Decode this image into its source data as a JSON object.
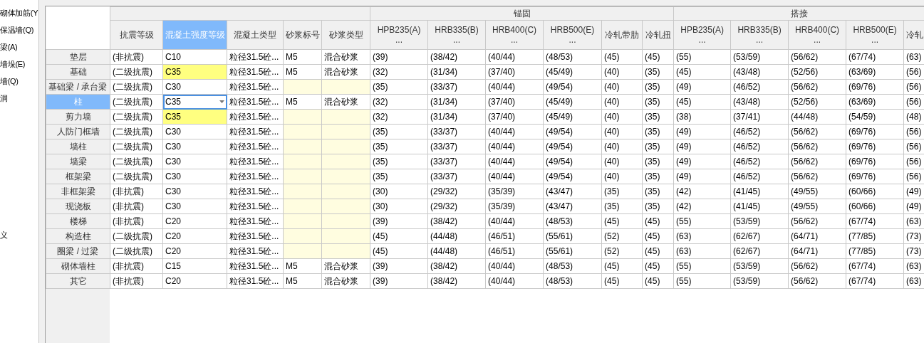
{
  "sidebar": {
    "items": [
      "砌体加筋(Y",
      "保温墙(Q)",
      "梁(A)",
      "墙垛(E)",
      "墙(Q)",
      "洞",
      "义"
    ]
  },
  "table": {
    "columns": [
      {
        "label": "抗震等级",
        "selected": false
      },
      {
        "label": "混凝土强度等级",
        "selected": true
      },
      {
        "label": "混凝土类型",
        "selected": false
      },
      {
        "label": "砂浆标号",
        "selected": false
      },
      {
        "label": "砂浆类型",
        "selected": false
      }
    ],
    "groups": [
      {
        "label": "锚固",
        "columns": [
          {
            "label": "HPB235(A)",
            "more": "...",
            "selected": false
          },
          {
            "label": "HRB335(B)",
            "more": "...",
            "selected": false
          },
          {
            "label": "HRB400(C)",
            "more": "...",
            "selected": false
          },
          {
            "label": "HRB500(E)",
            "more": "...",
            "selected": false
          },
          {
            "label": "冷轧带肋",
            "selected": false
          },
          {
            "label": "冷轧扭",
            "selected": false
          }
        ]
      },
      {
        "label": "搭接",
        "columns": [
          {
            "label": "HPB235(A)",
            "more": "...",
            "selected": false
          },
          {
            "label": "HRB335(B)",
            "more": "...",
            "selected": false
          },
          {
            "label": "HRB400(C)",
            "more": "...",
            "selected": false
          },
          {
            "label": "HRB500(E)",
            "more": "...",
            "selected": false
          },
          {
            "label": "冷轧",
            "selected": false
          }
        ]
      }
    ],
    "rows": [
      {
        "label": "垫层",
        "selected": false,
        "seismic": "(非抗震)",
        "grade": "C10",
        "grade_modified": false,
        "editing": false,
        "concrete": "粒径31.5砼...",
        "mortar": {
          "mark": "M5",
          "type": "混合砂浆"
        },
        "values": [
          "(39)",
          "(38/42)",
          "(40/44)",
          "(48/53)",
          "(45)",
          "(45)",
          "(55)",
          "(53/59)",
          "(56/62)",
          "(67/74)",
          "(63)"
        ]
      },
      {
        "label": "基础",
        "selected": false,
        "seismic": "(二级抗震)",
        "grade": "C35",
        "grade_modified": true,
        "editing": false,
        "concrete": "粒径31.5砼...",
        "mortar": {
          "mark": "M5",
          "type": "混合砂浆"
        },
        "values": [
          "(32)",
          "(31/34)",
          "(37/40)",
          "(45/49)",
          "(40)",
          "(35)",
          "(45)",
          "(43/48)",
          "(52/56)",
          "(63/69)",
          "(56)"
        ]
      },
      {
        "label": "基础梁 / 承台梁",
        "selected": false,
        "seismic": "(二级抗震)",
        "grade": "C30",
        "grade_modified": false,
        "editing": false,
        "concrete": "粒径31.5砼...",
        "mortar": null,
        "values": [
          "(35)",
          "(33/37)",
          "(40/44)",
          "(49/54)",
          "(40)",
          "(35)",
          "(49)",
          "(46/52)",
          "(56/62)",
          "(69/76)",
          "(56)"
        ]
      },
      {
        "label": "柱",
        "selected": true,
        "seismic": "(二级抗震)",
        "grade": "C35",
        "grade_modified": false,
        "editing": true,
        "concrete": "粒径31.5砼...",
        "mortar": {
          "mark": "M5",
          "type": "混合砂浆"
        },
        "values": [
          "(32)",
          "(31/34)",
          "(37/40)",
          "(45/49)",
          "(40)",
          "(35)",
          "(45)",
          "(43/48)",
          "(52/56)",
          "(63/69)",
          "(56)"
        ]
      },
      {
        "label": "剪力墙",
        "selected": false,
        "seismic": "(二级抗震)",
        "grade": "C35",
        "grade_modified": true,
        "editing": false,
        "concrete": "粒径31.5砼...",
        "mortar": null,
        "values": [
          "(32)",
          "(31/34)",
          "(37/40)",
          "(45/49)",
          "(40)",
          "(35)",
          "(38)",
          "(37/41)",
          "(44/48)",
          "(54/59)",
          "(48)"
        ]
      },
      {
        "label": "人防门框墙",
        "selected": false,
        "seismic": "(二级抗震)",
        "grade": "C30",
        "grade_modified": false,
        "editing": false,
        "concrete": "粒径31.5砼...",
        "mortar": null,
        "values": [
          "(35)",
          "(33/37)",
          "(40/44)",
          "(49/54)",
          "(40)",
          "(35)",
          "(49)",
          "(46/52)",
          "(56/62)",
          "(69/76)",
          "(56)"
        ]
      },
      {
        "label": "墙柱",
        "selected": false,
        "seismic": "(二级抗震)",
        "grade": "C30",
        "grade_modified": false,
        "editing": false,
        "concrete": "粒径31.5砼...",
        "mortar": null,
        "values": [
          "(35)",
          "(33/37)",
          "(40/44)",
          "(49/54)",
          "(40)",
          "(35)",
          "(49)",
          "(46/52)",
          "(56/62)",
          "(69/76)",
          "(56)"
        ]
      },
      {
        "label": "墙梁",
        "selected": false,
        "seismic": "(二级抗震)",
        "grade": "C30",
        "grade_modified": false,
        "editing": false,
        "concrete": "粒径31.5砼...",
        "mortar": null,
        "values": [
          "(35)",
          "(33/37)",
          "(40/44)",
          "(49/54)",
          "(40)",
          "(35)",
          "(49)",
          "(46/52)",
          "(56/62)",
          "(69/76)",
          "(56)"
        ]
      },
      {
        "label": "框架梁",
        "selected": false,
        "seismic": "(二级抗震)",
        "grade": "C30",
        "grade_modified": false,
        "editing": false,
        "concrete": "粒径31.5砼...",
        "mortar": null,
        "values": [
          "(35)",
          "(33/37)",
          "(40/44)",
          "(49/54)",
          "(40)",
          "(35)",
          "(49)",
          "(46/52)",
          "(56/62)",
          "(69/76)",
          "(56)"
        ]
      },
      {
        "label": "非框架梁",
        "selected": false,
        "seismic": "(非抗震)",
        "grade": "C30",
        "grade_modified": false,
        "editing": false,
        "concrete": "粒径31.5砼...",
        "mortar": null,
        "values": [
          "(30)",
          "(29/32)",
          "(35/39)",
          "(43/47)",
          "(35)",
          "(35)",
          "(42)",
          "(41/45)",
          "(49/55)",
          "(60/66)",
          "(49)"
        ]
      },
      {
        "label": "现浇板",
        "selected": false,
        "seismic": "(非抗震)",
        "grade": "C30",
        "grade_modified": false,
        "editing": false,
        "concrete": "粒径31.5砼...",
        "mortar": null,
        "values": [
          "(30)",
          "(29/32)",
          "(35/39)",
          "(43/47)",
          "(35)",
          "(35)",
          "(42)",
          "(41/45)",
          "(49/55)",
          "(60/66)",
          "(49)"
        ]
      },
      {
        "label": "楼梯",
        "selected": false,
        "seismic": "(非抗震)",
        "grade": "C20",
        "grade_modified": false,
        "editing": false,
        "concrete": "粒径31.5砼...",
        "mortar": null,
        "values": [
          "(39)",
          "(38/42)",
          "(40/44)",
          "(48/53)",
          "(45)",
          "(45)",
          "(55)",
          "(53/59)",
          "(56/62)",
          "(67/74)",
          "(63)"
        ]
      },
      {
        "label": "构造柱",
        "selected": false,
        "seismic": "(二级抗震)",
        "grade": "C20",
        "grade_modified": false,
        "editing": false,
        "concrete": "粒径31.5砼...",
        "mortar": null,
        "values": [
          "(45)",
          "(44/48)",
          "(46/51)",
          "(55/61)",
          "(52)",
          "(45)",
          "(63)",
          "(62/67)",
          "(64/71)",
          "(77/85)",
          "(73)"
        ]
      },
      {
        "label": "圈梁 / 过梁",
        "selected": false,
        "seismic": "(二级抗震)",
        "grade": "C20",
        "grade_modified": false,
        "editing": false,
        "concrete": "粒径31.5砼...",
        "mortar": null,
        "values": [
          "(45)",
          "(44/48)",
          "(46/51)",
          "(55/61)",
          "(52)",
          "(45)",
          "(63)",
          "(62/67)",
          "(64/71)",
          "(77/85)",
          "(73)"
        ]
      },
      {
        "label": "砌体墙柱",
        "selected": false,
        "seismic": "(非抗震)",
        "grade": "C15",
        "grade_modified": false,
        "editing": false,
        "concrete": "粒径31.5砼...",
        "mortar": {
          "mark": "M5",
          "type": "混合砂浆"
        },
        "values": [
          "(39)",
          "(38/42)",
          "(40/44)",
          "(48/53)",
          "(45)",
          "(45)",
          "(55)",
          "(53/59)",
          "(56/62)",
          "(67/74)",
          "(63)"
        ]
      },
      {
        "label": "其它",
        "selected": false,
        "seismic": "(非抗震)",
        "grade": "C20",
        "grade_modified": false,
        "editing": false,
        "concrete": "粒径31.5砼...",
        "mortar": {
          "mark": "M5",
          "type": "混合砂浆"
        },
        "values": [
          "(39)",
          "(38/42)",
          "(40/44)",
          "(48/53)",
          "(45)",
          "(45)",
          "(55)",
          "(53/59)",
          "(56/62)",
          "(67/74)",
          "(63)"
        ]
      }
    ]
  }
}
